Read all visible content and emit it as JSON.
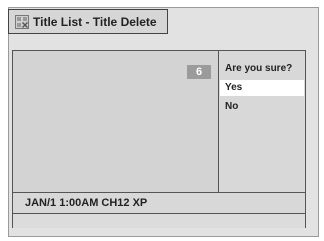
{
  "header": {
    "title": "Title List - Title Delete",
    "icon": "title-list-icon"
  },
  "preview": {
    "title_number": "6"
  },
  "dialog": {
    "question": "Are you sure?",
    "options": [
      {
        "label": "Yes",
        "selected": true
      },
      {
        "label": "No",
        "selected": false
      }
    ]
  },
  "status": {
    "info": "JAN/1 1:00AM CH12 XP"
  },
  "colors": {
    "background": "#e2e2e2",
    "highlight": "#ffffff",
    "badge": "#9b9b9b",
    "border": "#555555"
  }
}
